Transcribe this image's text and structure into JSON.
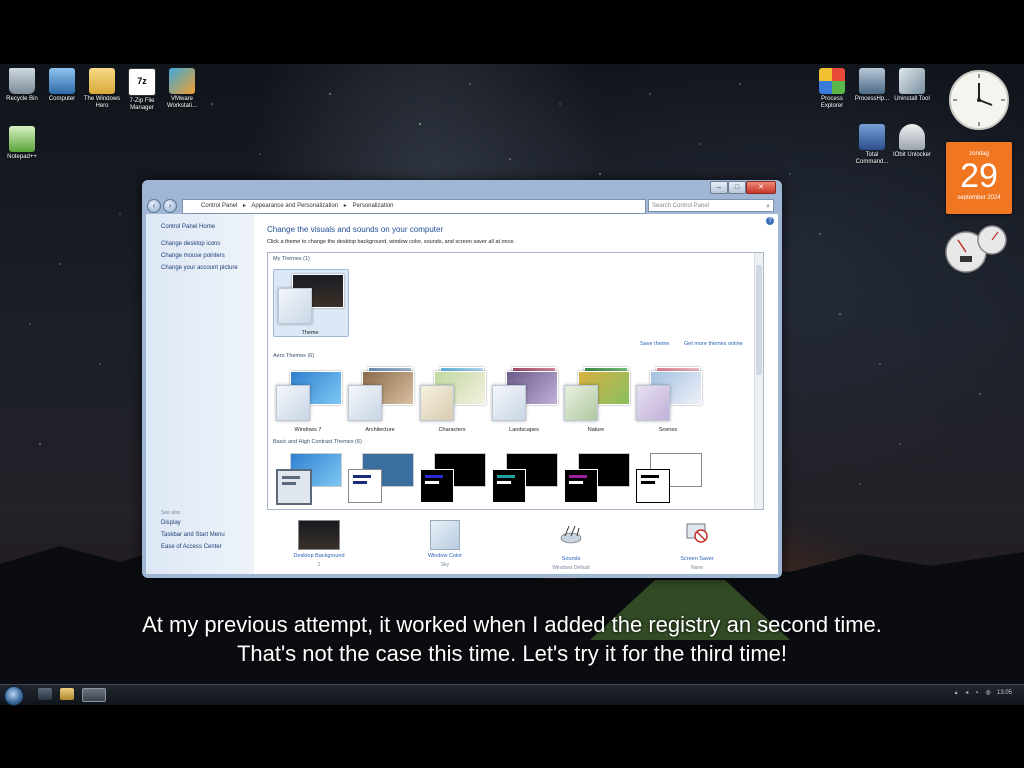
{
  "desktop": {
    "icons_left": [
      {
        "label": "Recycle Bin",
        "icon": "recycle-bin-icon"
      },
      {
        "label": "Computer",
        "icon": "computer-icon"
      },
      {
        "label": "The Windows Hero",
        "icon": "folder-icon"
      },
      {
        "label": "7-Zip File Manager",
        "icon": "7zip-icon"
      },
      {
        "label": "VMware Workstati...",
        "icon": "vmware-icon"
      },
      {
        "label": "Notepad++",
        "icon": "notepad-icon"
      }
    ],
    "icons_right": [
      {
        "label": "Process Explorer",
        "icon": "process-explorer-icon"
      },
      {
        "label": "ProcessHp...",
        "icon": "process-hacker-icon"
      },
      {
        "label": "Uninstall Tool",
        "icon": "uninstall-tool-icon"
      },
      {
        "label": "Total Command...",
        "icon": "total-commander-icon"
      },
      {
        "label": "IObit Unlocker",
        "icon": "iobit-unlocker-icon"
      }
    ],
    "calendar": {
      "day": "zondag",
      "date": "29",
      "month": "september 2024"
    }
  },
  "window": {
    "address": [
      "Control Panel",
      "Appearance and Personalization",
      "Personalization"
    ],
    "search_placeholder": "Search Control Panel",
    "sidebar": {
      "links": [
        "Control Panel Home",
        "Change desktop icons",
        "Change mouse pointers",
        "Change your account picture"
      ],
      "see_also_title": "See also",
      "see_also": [
        "Display",
        "Taskbar and Start Menu",
        "Ease of Access Center"
      ]
    },
    "heading": "Change the visuals and sounds on your computer",
    "subheading": "Click a theme to change the desktop background, window color, sounds, and screen saver all at once.",
    "my_themes": {
      "title": "My Themes (1)",
      "items": [
        {
          "label": "Theme"
        }
      ]
    },
    "save_theme": "Save theme",
    "get_more": "Get more themes online",
    "aero_themes": {
      "title": "Aero Themes (6)",
      "items": [
        {
          "label": "Windows 7"
        },
        {
          "label": "Architecture"
        },
        {
          "label": "Characters"
        },
        {
          "label": "Landscapes"
        },
        {
          "label": "Nature"
        },
        {
          "label": "Scenes"
        }
      ]
    },
    "basic_themes": {
      "title": "Basic and High Contrast Themes (6)"
    },
    "bottom": [
      {
        "label": "Desktop Background",
        "value": "1"
      },
      {
        "label": "Window Color",
        "value": "Sky"
      },
      {
        "label": "Sounds",
        "value": "Windows Default"
      },
      {
        "label": "Screen Saver",
        "value": "None"
      }
    ]
  },
  "subtitle": {
    "line1": "At my previous attempt, it worked when I added the registry an second time.",
    "line2": "That's not the case this time. Let's try it for the third time!"
  },
  "taskbar": {
    "clock": "13:05"
  },
  "colors": {
    "accent": "#1f4e93",
    "link": "#2a62b8",
    "calendar": "#f07622"
  }
}
